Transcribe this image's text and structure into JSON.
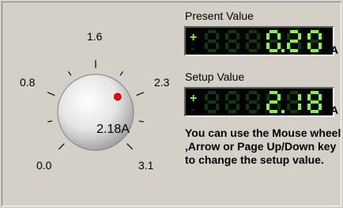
{
  "knob": {
    "value_label": "2.18A",
    "value": 2.18,
    "min": 0.0,
    "max": 3.1,
    "scale_labels": [
      "0.0",
      "0.8",
      "1.6",
      "2.3",
      "3.1"
    ],
    "indicator_color": "#ff0000"
  },
  "present": {
    "label": "Present Value",
    "sign_plus": "+",
    "sign_minus": "-",
    "digits": [
      "8",
      "8",
      "8",
      "0.",
      "2",
      "0"
    ],
    "unit": "A"
  },
  "setup": {
    "label": "Setup Value",
    "sign_plus": "+",
    "sign_minus": "-",
    "digits": [
      "8",
      "8",
      "8",
      "2.",
      "1",
      "8"
    ],
    "unit": "A"
  },
  "help_text": "You can use the Mouse wheel ,Arrow or Page Up/Down key to change the setup value.",
  "colors": {
    "lcd_on": "#7dff3a",
    "lcd_off": "#0e3a0e",
    "background": "#d4d0c8"
  }
}
